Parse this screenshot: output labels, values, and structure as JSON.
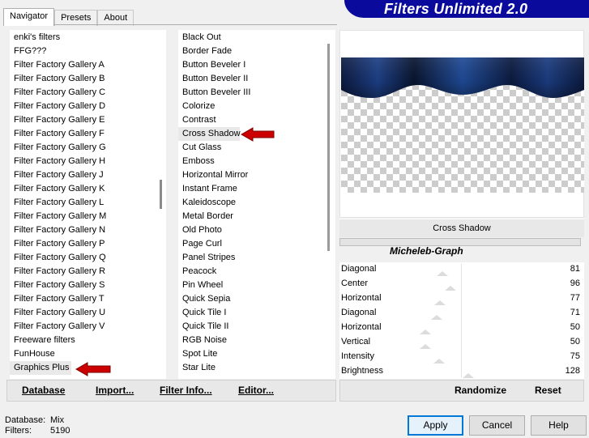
{
  "header": {
    "title": "Filters Unlimited 2.0"
  },
  "tabs": [
    {
      "label": "Navigator"
    },
    {
      "label": "Presets"
    },
    {
      "label": "About"
    }
  ],
  "categories": [
    "enki's filters",
    "FFG???",
    "Filter Factory Gallery A",
    "Filter Factory Gallery B",
    "Filter Factory Gallery C",
    "Filter Factory Gallery D",
    "Filter Factory Gallery E",
    "Filter Factory Gallery F",
    "Filter Factory Gallery G",
    "Filter Factory Gallery H",
    "Filter Factory Gallery J",
    "Filter Factory Gallery K",
    "Filter Factory Gallery L",
    "Filter Factory Gallery M",
    "Filter Factory Gallery N",
    "Filter Factory Gallery P",
    "Filter Factory Gallery Q",
    "Filter Factory Gallery R",
    "Filter Factory Gallery S",
    "Filter Factory Gallery T",
    "Filter Factory Gallery U",
    "Filter Factory Gallery V",
    "Freeware filters",
    "FunHouse",
    "Graphics Plus"
  ],
  "selected_category": "Graphics Plus",
  "filters": [
    "Black Out",
    "Border Fade",
    "Button Beveler I",
    "Button Beveler II",
    "Button Beveler III",
    "Colorize",
    "Contrast",
    "Cross Shadow",
    "Cut Glass",
    "Emboss",
    "Horizontal Mirror",
    "Instant Frame",
    "Kaleidoscope",
    "Metal Border",
    "Old Photo",
    "Page Curl",
    "Panel Stripes",
    "Peacock",
    "Pin Wheel",
    "Quick Sepia",
    "Quick Tile I",
    "Quick Tile II",
    "RGB Noise",
    "Spot Lite",
    "Star Lite"
  ],
  "selected_filter": "Cross Shadow",
  "preview": {
    "filter_name": "Cross Shadow",
    "author": "Micheleb-Graph"
  },
  "parameters": [
    {
      "label": "Diagonal",
      "value": "81",
      "level": 81
    },
    {
      "label": "Center",
      "value": "96",
      "level": 96
    },
    {
      "label": "Horizontal",
      "value": "77",
      "level": 77
    },
    {
      "label": "Diagonal",
      "value": "71",
      "level": 71
    },
    {
      "label": "Horizontal",
      "value": "50",
      "level": 50
    },
    {
      "label": "Vertical",
      "value": "50",
      "level": 50
    },
    {
      "label": "Intensity",
      "value": "75",
      "level": 75
    },
    {
      "label": "Brightness",
      "value": "128",
      "level": 128
    }
  ],
  "left_toolbar": {
    "database": "Database",
    "import": "Import...",
    "filter_info": "Filter Info...",
    "editor": "Editor..."
  },
  "right_toolbar": {
    "randomize": "Randomize",
    "reset": "Reset"
  },
  "status": {
    "database_label": "Database:",
    "database_value": "Mix",
    "filters_label": "Filters:",
    "filters_value": "5190"
  },
  "buttons": {
    "apply": "Apply",
    "cancel": "Cancel",
    "help": "Help"
  },
  "colors": {
    "banner": "#0a0a9c",
    "arrow": "#cc0000",
    "accent": "#0078d7"
  }
}
